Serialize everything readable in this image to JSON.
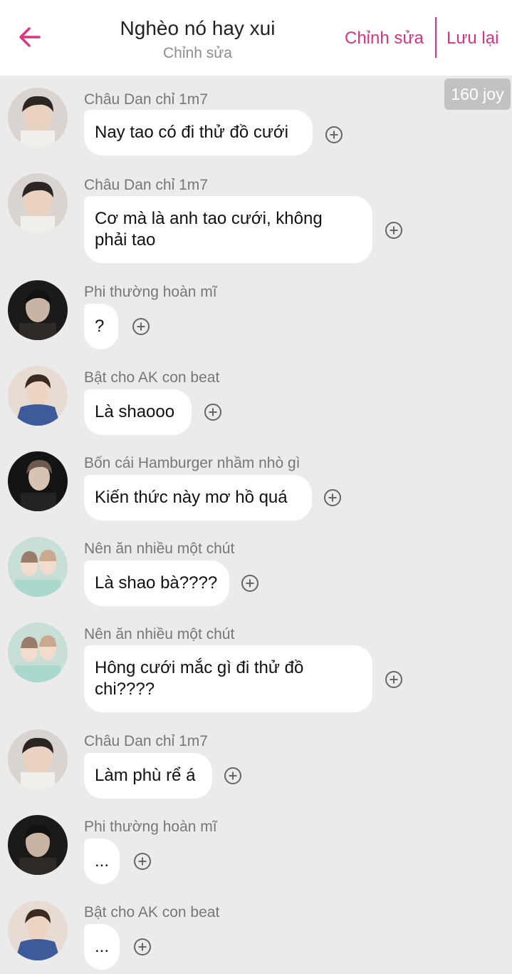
{
  "header": {
    "title": "Nghèo nó hay xui",
    "subtitle": "Chỉnh sửa",
    "edit_label": "Chỉnh sửa",
    "save_label": "Lưu lại"
  },
  "joy_badge": "160 joy",
  "colors": {
    "accent": "#e0337f",
    "background": "#ebebeb",
    "bubble": "#ffffff",
    "sender_text": "#777777"
  },
  "messages": [
    {
      "sender": "Châu Dan chỉ 1m7",
      "lines": [
        "Nay tao có đi thử đồ cưới"
      ]
    },
    {
      "sender": "Châu Dan chỉ 1m7",
      "lines": [
        "Cơ mà là anh tao cưới, không",
        "phải tao"
      ]
    },
    {
      "sender": "Phi thường hoàn mĩ",
      "lines": [
        "?"
      ]
    },
    {
      "sender": "Bật cho AK con beat",
      "lines": [
        "Là shaooo"
      ]
    },
    {
      "sender": "Bốn cái Hamburger nhầm nhò gì",
      "lines": [
        "Kiến thức này mơ hồ quá"
      ]
    },
    {
      "sender": "Nên ăn nhiều một chút",
      "lines": [
        "Là shao bà????"
      ]
    },
    {
      "sender": "Nên ăn nhiều một chút",
      "lines": [
        "Hông cưới mắc gì đi thử đồ",
        "chi????"
      ]
    },
    {
      "sender": "Châu Dan chỉ 1m7",
      "lines": [
        "Làm phù rể á"
      ]
    },
    {
      "sender": "Phi thường hoàn mĩ",
      "lines": [
        "..."
      ]
    },
    {
      "sender": "Bật cho AK con beat",
      "lines": [
        "..."
      ]
    }
  ]
}
